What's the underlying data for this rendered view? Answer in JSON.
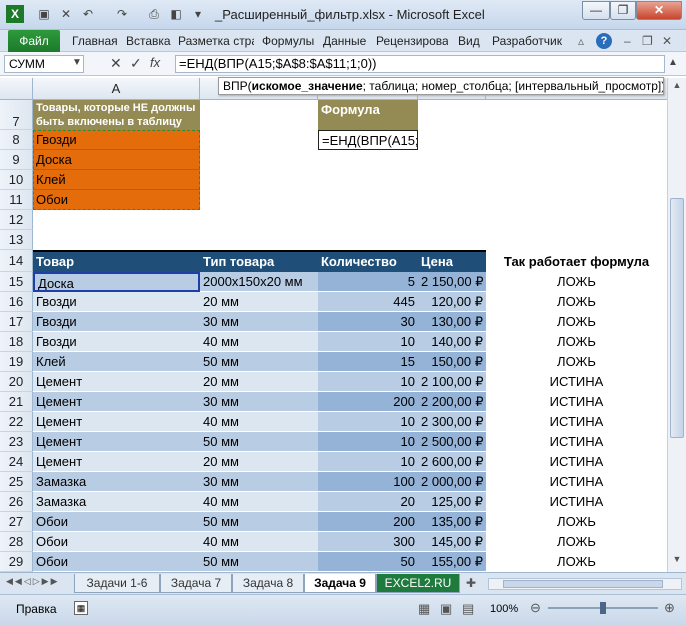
{
  "window": {
    "title": "_Расширенный_фильтр.xlsx - Microsoft Excel"
  },
  "ribbon": {
    "tabs": [
      "Файл",
      "Главная",
      "Вставка",
      "Разметка стра",
      "Формулы",
      "Данные",
      "Рецензирова",
      "Вид",
      "Разработчик"
    ]
  },
  "formula_bar": {
    "name_box": "СУММ",
    "content": "=ЕНД(ВПР(A15;$A$8:$A$11;1;0))",
    "tooltip": "ВПР(искомое_значение; таблица; номер_столбца; [интервальный_просмотр])"
  },
  "columns": {
    "A": "A"
  },
  "rows": {
    "top": [
      "7",
      "8",
      "9",
      "10",
      "11",
      "12",
      "13",
      "14"
    ],
    "data": [
      "15",
      "16",
      "17",
      "18",
      "19",
      "20",
      "21",
      "22",
      "23",
      "24",
      "25",
      "26",
      "27",
      "28",
      "29"
    ]
  },
  "exclude_header": "Товары, которые НЕ должны быть включены в таблицу",
  "exclude_items": [
    "Гвозди",
    "Доска",
    "Клей",
    "Обои"
  ],
  "formula_header": "Формула",
  "formula_cell": "=ЕНД(ВПР(A15;$",
  "table": {
    "headers": [
      "Товар",
      "Тип товара",
      "Количество",
      "Цена"
    ],
    "side_header": "Так работает формула",
    "rows": [
      [
        "Доска",
        "2000x150x20 мм",
        "5",
        "2 150,00 ₽",
        "ЛОЖЬ"
      ],
      [
        "Гвозди",
        "20 мм",
        "445",
        "120,00 ₽",
        "ЛОЖЬ"
      ],
      [
        "Гвозди",
        "30 мм",
        "30",
        "130,00 ₽",
        "ЛОЖЬ"
      ],
      [
        "Гвозди",
        "40 мм",
        "10",
        "140,00 ₽",
        "ЛОЖЬ"
      ],
      [
        "Клей",
        "50 мм",
        "15",
        "150,00 ₽",
        "ЛОЖЬ"
      ],
      [
        "Цемент",
        "20 мм",
        "10",
        "2 100,00 ₽",
        "ИСТИНА"
      ],
      [
        "Цемент",
        "30 мм",
        "200",
        "2 200,00 ₽",
        "ИСТИНА"
      ],
      [
        "Цемент",
        "40 мм",
        "10",
        "2 300,00 ₽",
        "ИСТИНА"
      ],
      [
        "Цемент",
        "50 мм",
        "10",
        "2 500,00 ₽",
        "ИСТИНА"
      ],
      [
        "Цемент",
        "20 мм",
        "10",
        "2 600,00 ₽",
        "ИСТИНА"
      ],
      [
        "Замазка",
        "30 мм",
        "100",
        "2 000,00 ₽",
        "ИСТИНА"
      ],
      [
        "Замазка",
        "40 мм",
        "20",
        "125,00 ₽",
        "ИСТИНА"
      ],
      [
        "Обои",
        "50 мм",
        "200",
        "135,00 ₽",
        "ЛОЖЬ"
      ],
      [
        "Обои",
        "40 мм",
        "300",
        "145,00 ₽",
        "ЛОЖЬ"
      ],
      [
        "Обои",
        "50 мм",
        "50",
        "155,00 ₽",
        "ЛОЖЬ"
      ]
    ]
  },
  "sheets": [
    "Задачи 1-6",
    "Задача 7",
    "Задача 8",
    "Задача 9",
    "EXCEL2.RU"
  ],
  "status": {
    "mode": "Правка",
    "zoom": "100%"
  },
  "colors": {
    "orange": "#e46c0a",
    "olive": "#948a54",
    "header_blue": "#1f4e79",
    "band": "#dce6f1",
    "band_dark": "#b8cce4"
  }
}
